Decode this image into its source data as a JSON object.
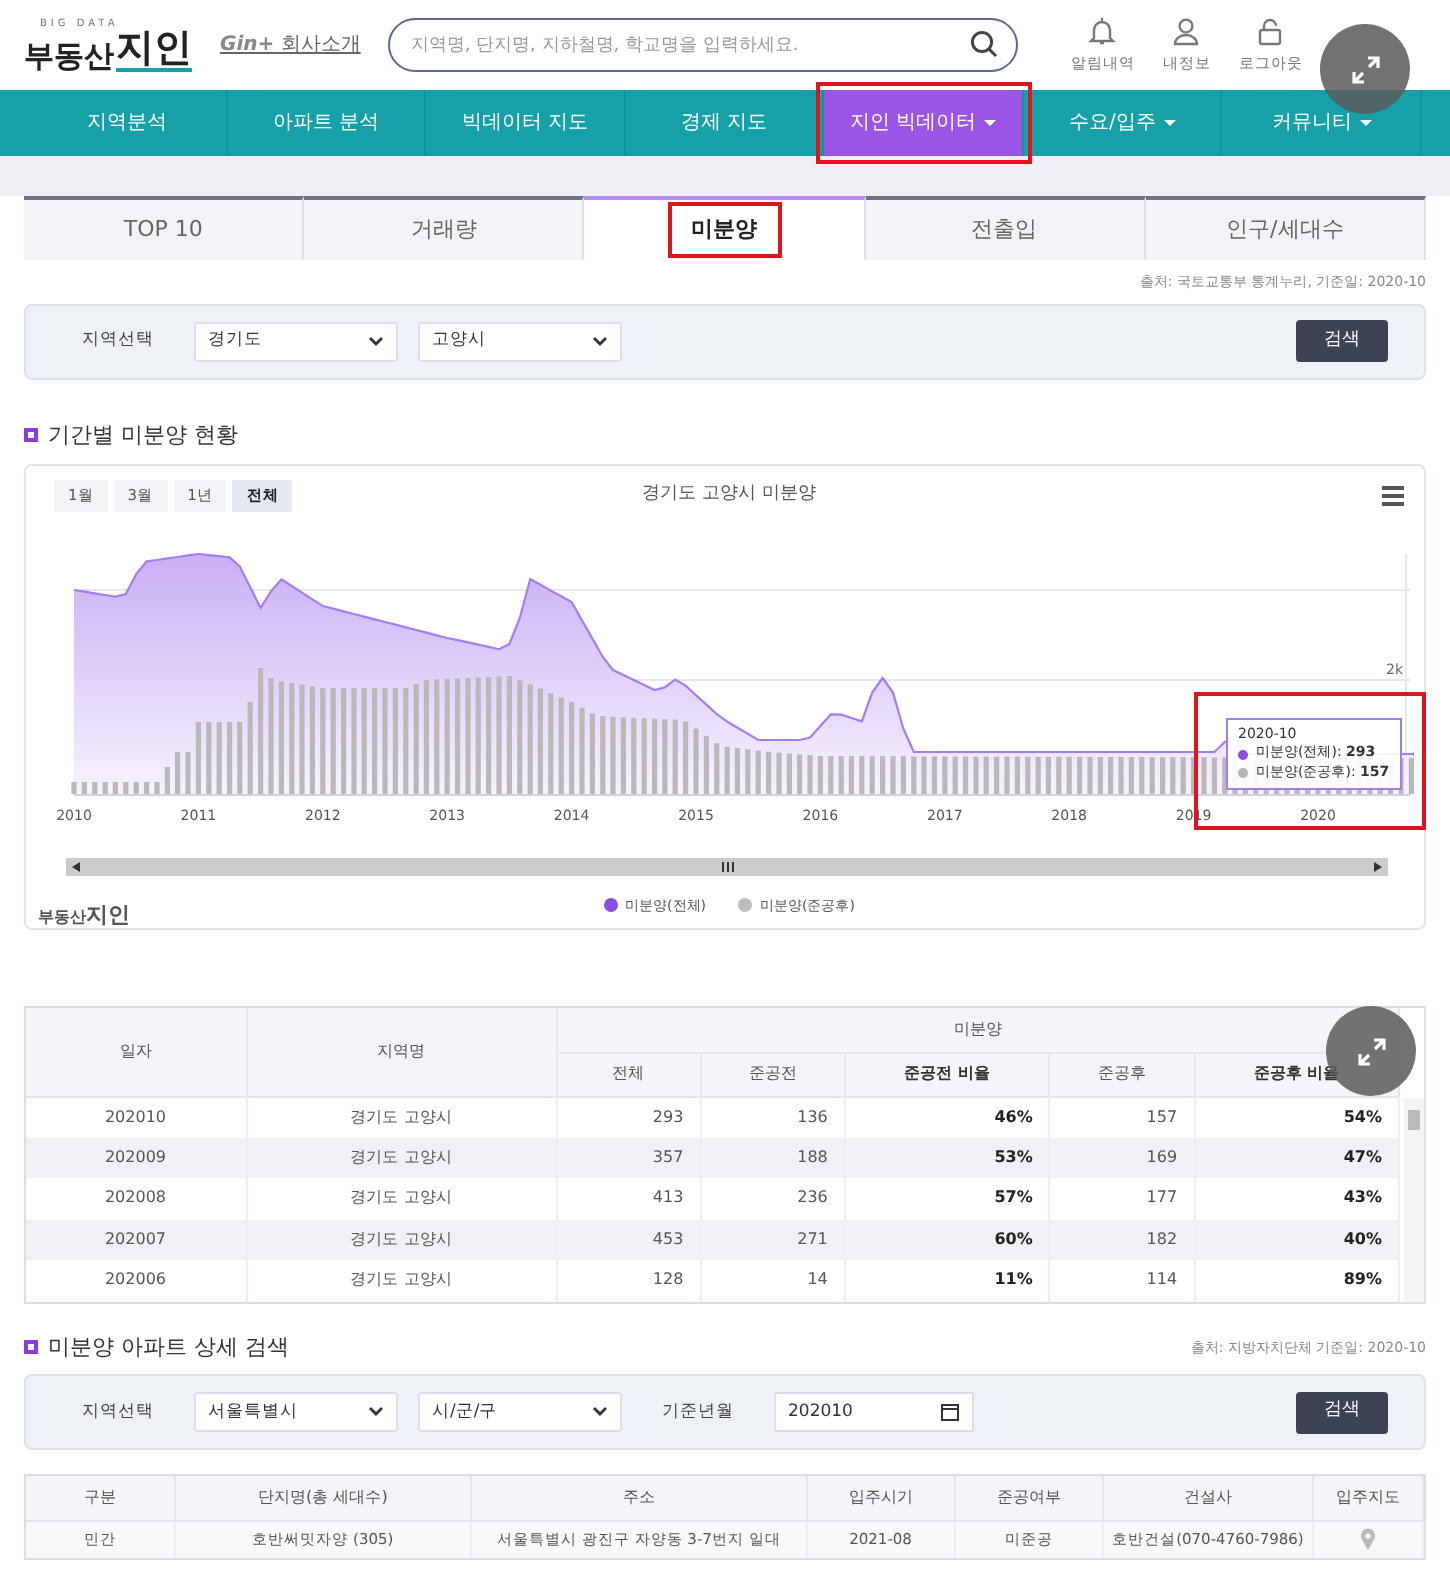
{
  "header": {
    "logo_tag": "BIG DATA",
    "logo_main": "부동산",
    "logo_brand": "지인",
    "about": {
      "brand": "Gin+",
      "label": "회사소개"
    },
    "search": {
      "placeholder": "지역명, 단지명, 지하철명, 학교명을 입력하세요."
    },
    "user_menu": [
      {
        "kind": "bell",
        "label": "알림내역"
      },
      {
        "kind": "person",
        "label": "내정보"
      },
      {
        "kind": "lock",
        "label": "로그아웃"
      }
    ]
  },
  "nav": [
    {
      "label": "지역분석",
      "dropdown": false,
      "selected": false,
      "highlighted": false
    },
    {
      "label": "아파트 분석",
      "dropdown": false,
      "selected": false,
      "highlighted": false
    },
    {
      "label": "빅데이터 지도",
      "dropdown": false,
      "selected": false,
      "highlighted": false
    },
    {
      "label": "경제 지도",
      "dropdown": false,
      "selected": false,
      "highlighted": false
    },
    {
      "label": "지인 빅데이터",
      "dropdown": true,
      "selected": true,
      "highlighted": true
    },
    {
      "label": "수요/입주",
      "dropdown": true,
      "selected": false,
      "highlighted": false
    },
    {
      "label": "커뮤니티",
      "dropdown": true,
      "selected": false,
      "highlighted": false
    }
  ],
  "tabs": [
    {
      "label": "TOP 10",
      "selected": false,
      "highlighted": false
    },
    {
      "label": "거래량",
      "selected": false,
      "highlighted": false
    },
    {
      "label": "미분양",
      "selected": true,
      "highlighted": true
    },
    {
      "label": "전출입",
      "selected": false,
      "highlighted": false
    },
    {
      "label": "인구/세대수",
      "selected": false,
      "highlighted": false
    }
  ],
  "source_1": "출처: 국토교통부 통계누리,  기준일: 2020-10",
  "filter_1": {
    "label": "지역선택",
    "selects": [
      "경기도",
      "고양시"
    ],
    "button": "검색"
  },
  "section_1": "기간별 미분양 현황",
  "chart": {
    "ranges": [
      {
        "label": "1월",
        "selected": false
      },
      {
        "label": "3월",
        "selected": false
      },
      {
        "label": "1년",
        "selected": false
      },
      {
        "label": "전체",
        "selected": true
      }
    ],
    "title": "경기도 고양시 미분양",
    "y_label": "2k",
    "x_labels": [
      "2010",
      "2011",
      "2012",
      "2013",
      "2014",
      "2015",
      "2016",
      "2017",
      "2018",
      "2019",
      "2020"
    ],
    "tooltip": {
      "date": "2020-10",
      "lines": [
        {
          "label": "미분양(전체): ",
          "value": "293",
          "color": "#8a4fe0"
        },
        {
          "label": "미분양(준공후): ",
          "value": "157",
          "color": "#b5b5b5"
        }
      ]
    },
    "highlighted": true,
    "legend": [
      {
        "label": "미분양(전체)",
        "color": "#8a4fe0"
      },
      {
        "label": "미분양(준공후)",
        "color": "#bdbdbd"
      }
    ],
    "credit_main": "부동산",
    "credit_brand": "지인"
  },
  "table_1": {
    "group": "미분양",
    "columns": [
      {
        "label": "일자",
        "bold": false
      },
      {
        "label": "지역명",
        "bold": false
      },
      {
        "label": "전체",
        "bold": false
      },
      {
        "label": "준공전",
        "bold": false
      },
      {
        "label": "준공전 비율",
        "bold": true
      },
      {
        "label": "준공후",
        "bold": false
      },
      {
        "label": "준공후 비율",
        "bold": true
      }
    ],
    "rows": [
      [
        "202010",
        "경기도 고양시",
        "293",
        "136",
        "46%",
        "157",
        "54%"
      ],
      [
        "202009",
        "경기도 고양시",
        "357",
        "188",
        "53%",
        "169",
        "47%"
      ],
      [
        "202008",
        "경기도 고양시",
        "413",
        "236",
        "57%",
        "177",
        "43%"
      ],
      [
        "202007",
        "경기도 고양시",
        "453",
        "271",
        "60%",
        "182",
        "40%"
      ],
      [
        "202006",
        "경기도 고양시",
        "128",
        "14",
        "11%",
        "114",
        "89%"
      ]
    ]
  },
  "section_2": {
    "title": "미분양 아파트 상세 검색",
    "source": "출처: 지방자치단체  기준일: 2020-10"
  },
  "filter_2": {
    "label": "지역선택",
    "selects": [
      "서울특별시",
      "시/군/구"
    ],
    "date_label": "기준년월",
    "date_value": "202010",
    "button": "검색"
  },
  "table_2": {
    "columns": [
      "구분",
      "단지명(총 세대수)",
      "주소",
      "입주시기",
      "준공여부",
      "건설사",
      "입주지도"
    ],
    "rows": [
      {
        "type": "민간",
        "name": "호반써밋자양 (305)",
        "address": "서울특별시 광진구 자양동 3-7번지 일대",
        "move_in": "2021-08",
        "completion": "미준공",
        "builder": "호반건설(070-4760-7986)"
      }
    ]
  },
  "overlays": [
    {
      "kind": "expand"
    },
    {
      "kind": "expand"
    }
  ]
}
